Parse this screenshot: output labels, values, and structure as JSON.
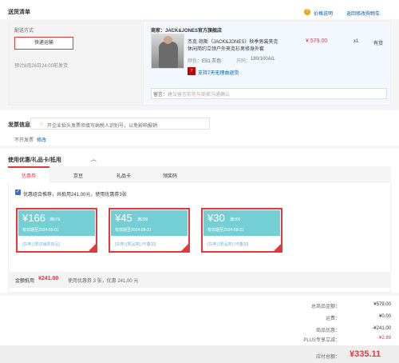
{
  "header": {
    "title": "送货清单",
    "help_link": "价格说明",
    "back_link": "返回修改购物车"
  },
  "delivery": {
    "method_label": "配送方式",
    "method_button": "快递运输",
    "eta": "预计8月28日24:00前发货",
    "store": "商家：JACK&JONES官方旗舰店",
    "product_title_1": "杰克·琼斯（JACK&JONES）秋季男装夹克",
    "product_title_2": "休闲简约立领户外夹克衫男修身外套",
    "color_label": "颜色：",
    "color_value": "E51 灰色",
    "size_label": "尺码：",
    "size_value": "180/100A/L",
    "return_badge": "7",
    "return_text": "支持7天无理由退货",
    "price": "¥ 579.00",
    "qty": "x1",
    "stock": "有货",
    "remark_label": "留言：",
    "remark_placeholder": "建议留言前先与商家沟通确认"
  },
  "invoice": {
    "title": "发票信息",
    "tip": "开企业抬头发票须填写纳税人识别号，以免影响报销",
    "status": "不开发票",
    "edit": "修改"
  },
  "coupons": {
    "title": "使用优惠/礼品卡/抵用",
    "tabs": [
      "优惠券",
      "京豆",
      "礼品卡",
      "领奖码"
    ],
    "recommend": "优惠组合推荐，共抵用241.00元，使用优惠券3张",
    "items": [
      {
        "amount": "¥166",
        "cond": "满579",
        "expire": "有效期至2024-09-01",
        "tags": "[东券] [限店铺限商品]"
      },
      {
        "amount": "¥45",
        "cond": "满299",
        "expire": "有效期至2024-08-31",
        "tags": "[东券] [限品类] [可叠加]"
      },
      {
        "amount": "¥30",
        "cond": "满300",
        "expire": "有效期至2024-08-31",
        "tags": "[东券] [限品类] [可叠加]"
      }
    ],
    "footer_label": "金额抵用",
    "footer_amount": "¥241.00",
    "footer_desc": "使用优惠券 3 张，优惠 241.00 元"
  },
  "summary": {
    "rows": [
      {
        "label": "总商品金额：",
        "value": "¥579.00"
      },
      {
        "label": "运费：",
        "value": "¥0.00"
      },
      {
        "label": "商品优惠：",
        "value": "-¥241.00"
      },
      {
        "label": "PLUS专享立减：",
        "value": "-¥2.89"
      }
    ],
    "total_label": "应付总额：",
    "total_value": "¥335.11"
  },
  "colors": {
    "accent": "#e4393c",
    "coupon": "#73cfd4",
    "link": "#005ea7"
  }
}
